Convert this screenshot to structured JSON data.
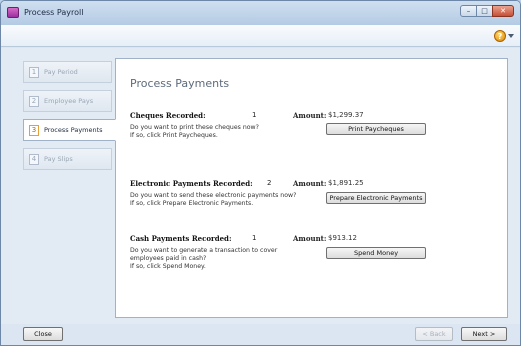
{
  "window": {
    "title": "Process Payroll"
  },
  "steps": [
    {
      "num": "1",
      "label": "Pay Period",
      "active": false
    },
    {
      "num": "2",
      "label": "Employee Pays",
      "active": false
    },
    {
      "num": "3",
      "label": "Process Payments",
      "active": true
    },
    {
      "num": "4",
      "label": "Pay Slips",
      "active": false
    }
  ],
  "panel": {
    "title": "Process Payments",
    "amount_label": "Amount:",
    "cheques": {
      "label": "Cheques Recorded:",
      "count": "1",
      "amount": "$1,299.37",
      "question": "Do you want to print these cheques now?",
      "hint": "If so, click Print Paycheques.",
      "button": "Print Paycheques"
    },
    "electronic": {
      "label": "Electronic Payments Recorded:",
      "count": "2",
      "amount": "$1,891.25",
      "question": "Do you want to send these electronic payments now?",
      "hint": "If so, click Prepare Electronic Payments.",
      "button": "Prepare Electronic Payments"
    },
    "cash": {
      "label": "Cash Payments Recorded:",
      "count": "1",
      "amount": "$913.12",
      "question": "Do you want to generate a transaction to cover employees paid in cash?",
      "hint": "If so, click Spend Money.",
      "button": "Spend Money"
    }
  },
  "footer": {
    "close": "Close",
    "back": "< Back",
    "next": "Next >"
  },
  "colors": {
    "active_step_accent": "#e2a03a",
    "help_icon": "#e08a00"
  }
}
